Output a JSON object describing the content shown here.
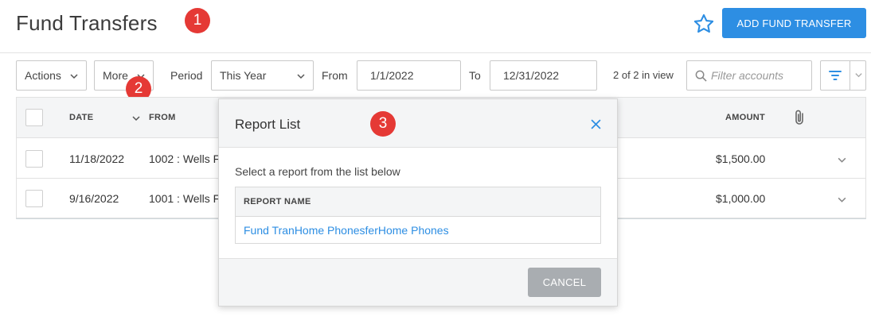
{
  "page": {
    "title": "Fund Transfers"
  },
  "badges": [
    "1",
    "2",
    "3"
  ],
  "header": {
    "add_button": "ADD FUND TRANSFER",
    "favorite_icon": "star-outline-icon"
  },
  "toolbar": {
    "actions_label": "Actions",
    "more_label": "More",
    "period_label": "Period",
    "period_value": "This Year",
    "from_label": "From",
    "from_value": "1/1/2022",
    "to_label": "To",
    "to_value": "12/31/2022",
    "view_count": "2 of 2 in view",
    "filter_placeholder": "Filter accounts"
  },
  "table": {
    "columns": {
      "date": "DATE",
      "from": "FROM",
      "amount": "AMOUNT"
    },
    "rows": [
      {
        "date": "11/18/2022",
        "from": "1002 : Wells F",
        "amount": "$1,500.00"
      },
      {
        "date": "9/16/2022",
        "from": "1001 : Wells F",
        "amount": "$1,000.00"
      }
    ]
  },
  "modal": {
    "title": "Report List",
    "instruction": "Select a report from the list below",
    "column_header": "REPORT NAME",
    "reports": [
      "Fund TranHome PhonesferHome Phones"
    ],
    "cancel_label": "CANCEL"
  },
  "colors": {
    "accent": "#2d8ee3",
    "badge": "#e53935",
    "cancel": "#a9adb1"
  }
}
